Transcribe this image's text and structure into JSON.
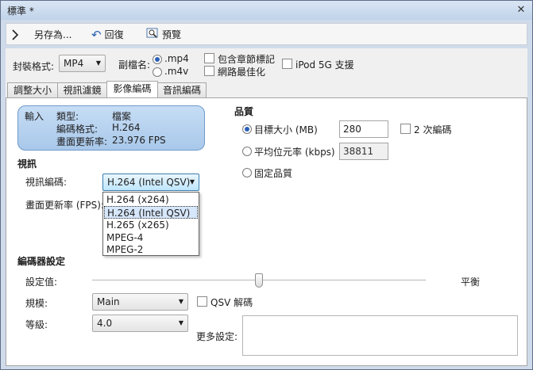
{
  "window": {
    "title": "標準 *"
  },
  "toolbar": {
    "save_as": "另存為...",
    "revert": "回復",
    "preview": "預覽"
  },
  "container": {
    "label": "封裝格式:",
    "value": "MP4",
    "ext_label": "副檔名:",
    "ext_options": [
      ".mp4",
      ".m4v"
    ],
    "chapter_markers": "包含章節標記",
    "web_optimized": "網路最佳化",
    "ipod": "iPod 5G 支援"
  },
  "tabs": [
    "調整大小",
    "視訊濾鏡",
    "影像編碼",
    "音訊編碼"
  ],
  "source": {
    "title": "輸入",
    "rows": [
      {
        "label": "類型:",
        "value": "檔案"
      },
      {
        "label": "編碼格式:",
        "value": "H.264"
      },
      {
        "label": "畫面更新率:",
        "value": "23.976 FPS"
      }
    ]
  },
  "video": {
    "section": "視訊",
    "encoder_label": "視訊編碼:",
    "encoder_value": "H.264 (Intel QSV)",
    "fps_label": "畫面更新率 (FPS):",
    "encoder_options": [
      "H.264 (x264)",
      "H.264 (Intel QSV)",
      "H.265 (x265)",
      "MPEG-4",
      "MPEG-2"
    ]
  },
  "quality": {
    "section": "品質",
    "target_size_label": "目標大小 (MB)",
    "target_size_value": "280",
    "two_pass": "2 次編碼",
    "avg_bitrate_label": "平均位元率 (kbps)",
    "avg_bitrate_value": "38811",
    "constant_quality": "固定品質"
  },
  "encoder_settings": {
    "section": "編碼器設定",
    "preset_label": "設定值:",
    "preset_value_label": "平衡",
    "profile_label": "規模:",
    "profile_value": "Main",
    "qsv_decode": "QSV 解碼",
    "level_label": "等級:",
    "level_value": "4.0",
    "more_settings_label": "更多設定:"
  }
}
